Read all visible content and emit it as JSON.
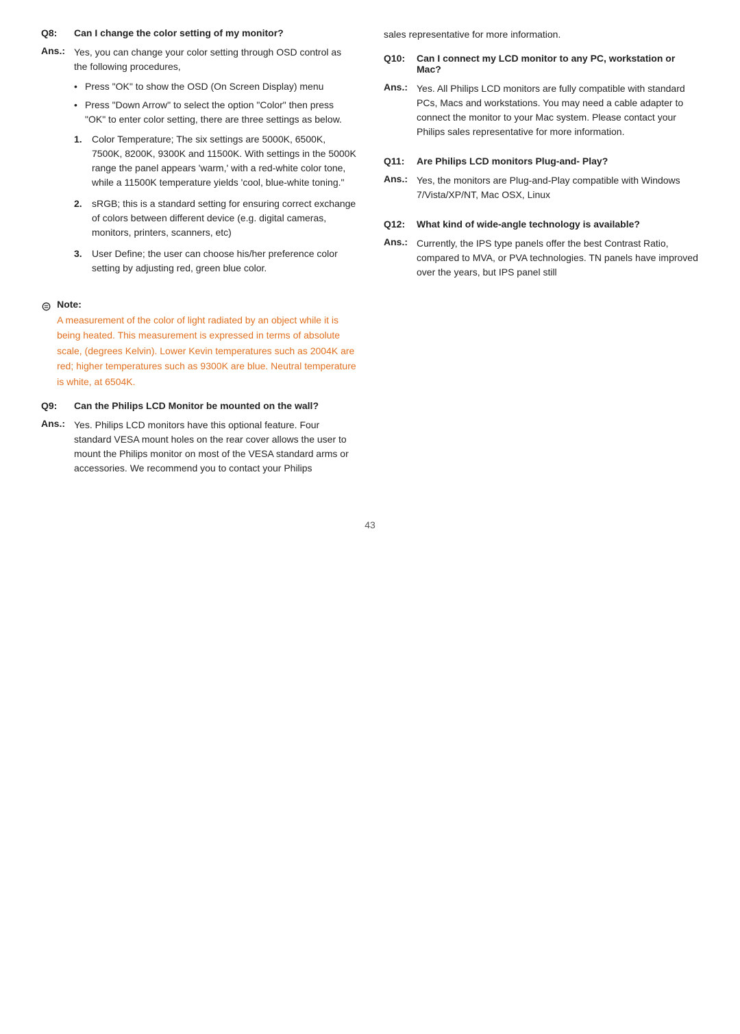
{
  "page": {
    "number": "43"
  },
  "left": {
    "q8": {
      "label": "Q8:",
      "question": "Can I change the color setting of my monitor?",
      "answer_label": "Ans.:",
      "answer_intro": "Yes, you can change your color setting through OSD control as the following procedures,",
      "bullets": [
        "Press \"OK\" to show the OSD (On Screen Display) menu",
        "Press \"Down Arrow\" to select the option \"Color\" then press \"OK\" to enter color setting, there are three settings as below."
      ],
      "numbered": [
        {
          "num": "1.",
          "text": "Color Temperature; The six settings are 5000K, 6500K, 7500K, 8200K, 9300K and 11500K. With settings in the 5000K range the panel appears 'warm,' with a red-white color tone, while a 11500K temperature yields 'cool, blue-white toning.\""
        },
        {
          "num": "2.",
          "text": "sRGB; this is a standard setting for ensuring correct exchange of colors between different device (e.g. digital cameras, monitors, printers, scanners, etc)"
        },
        {
          "num": "3.",
          "text": "User Define; the user can choose his/her preference color setting by adjusting red, green blue color."
        }
      ]
    },
    "note": {
      "label": "Note:",
      "icon": "🖨",
      "text": "A measurement of the color of light radiated by an object while it is being heated. This measurement is expressed in terms of absolute scale, (degrees Kelvin). Lower Kevin temperatures such as 2004K are red; higher temperatures such as 9300K are blue. Neutral temperature is white, at 6504K."
    },
    "q9": {
      "label": "Q9:",
      "question": "Can the Philips LCD Monitor be  mounted on the wall?",
      "answer_label": "Ans.:",
      "answer_text": "Yes. Philips LCD monitors have this optional feature. Four standard VESA mount holes on the rear cover allows the user to mount the Philips monitor on most of the VESA standard arms or accessories. We recommend you to contact your Philips"
    }
  },
  "right": {
    "intro_text": "sales representative for more information.",
    "q10": {
      "label": "Q10:",
      "question": "Can I connect my LCD monitor to any PC, workstation or Mac?",
      "answer_label": "Ans.:",
      "answer_text": "Yes. All Philips LCD monitors are fully compatible with standard PCs, Macs and workstations. You may need a cable adapter to connect the monitor to your Mac system. Please contact your Philips sales representative for more information."
    },
    "q11": {
      "label": "Q11:",
      "question": "Are Philips LCD monitors Plug-and- Play?",
      "answer_label": "Ans.:",
      "answer_text": "Yes, the monitors are Plug-and-Play compatible with Windows 7/Vista/XP/NT, Mac OSX, Linux"
    },
    "q12": {
      "label": "Q12:",
      "question": "What kind of wide-angle technology is available?",
      "answer_label": "Ans.:",
      "answer_text": "Currently, the IPS type panels offer the best Contrast Ratio, compared to MVA, or PVA technologies.  TN panels have improved over the years, but IPS panel still"
    }
  }
}
